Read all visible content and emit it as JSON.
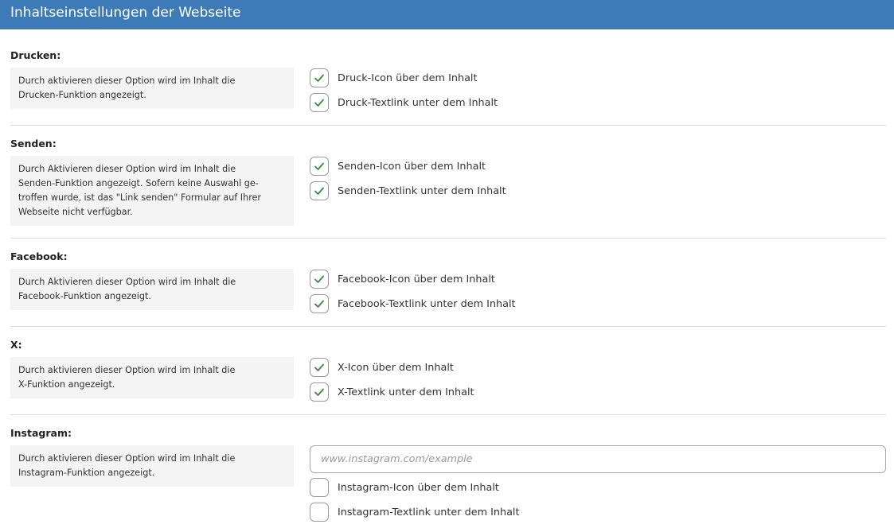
{
  "header": {
    "title": "Inhaltseinstellungen der Webseite"
  },
  "colors": {
    "header_bg": "#3d7ab8",
    "check": "#3a8a3a"
  },
  "sections": [
    {
      "title": "Drucken:",
      "description": "Durch aktivieren dieser Option wird im Inhalt die\nDrucken-Funktion angezeigt.",
      "options": [
        {
          "label": "Druck-Icon über dem Inhalt",
          "checked": true
        },
        {
          "label": "Druck-Textlink unter dem Inhalt",
          "checked": true
        }
      ]
    },
    {
      "title": "Senden:",
      "description": "Durch Aktivieren dieser Option wird im Inhalt die\nSenden-Funktion angezeigt. Sofern keine Auswahl ge-\ntroffen wurde, ist das \"Link senden\" Formular auf Ihrer\nWebseite nicht verfügbar.",
      "options": [
        {
          "label": "Senden-Icon über dem Inhalt",
          "checked": true
        },
        {
          "label": "Senden-Textlink unter dem Inhalt",
          "checked": true
        }
      ]
    },
    {
      "title": "Facebook:",
      "description": "Durch Aktivieren dieser Option wird im Inhalt die\nFacebook-Funktion angezeigt.",
      "options": [
        {
          "label": "Facebook-Icon über dem Inhalt",
          "checked": true
        },
        {
          "label": "Facebook-Textlink unter dem Inhalt",
          "checked": true
        }
      ]
    },
    {
      "title": "X:",
      "description": "Durch aktivieren dieser Option wird im Inhalt die\nX-Funktion angezeigt.",
      "options": [
        {
          "label": "X-Icon über dem Inhalt",
          "checked": true
        },
        {
          "label": "X-Textlink unter dem Inhalt",
          "checked": true
        }
      ]
    },
    {
      "title": "Instagram:",
      "description": "Durch aktivieren dieser Option wird im Inhalt die\nInstagram-Funktion angezeigt.",
      "url_input": {
        "value": "",
        "placeholder": "www.instagram.com/example"
      },
      "options": [
        {
          "label": "Instagram-Icon über dem Inhalt",
          "checked": false
        },
        {
          "label": "Instagram-Textlink unter dem Inhalt",
          "checked": false
        }
      ]
    }
  ]
}
